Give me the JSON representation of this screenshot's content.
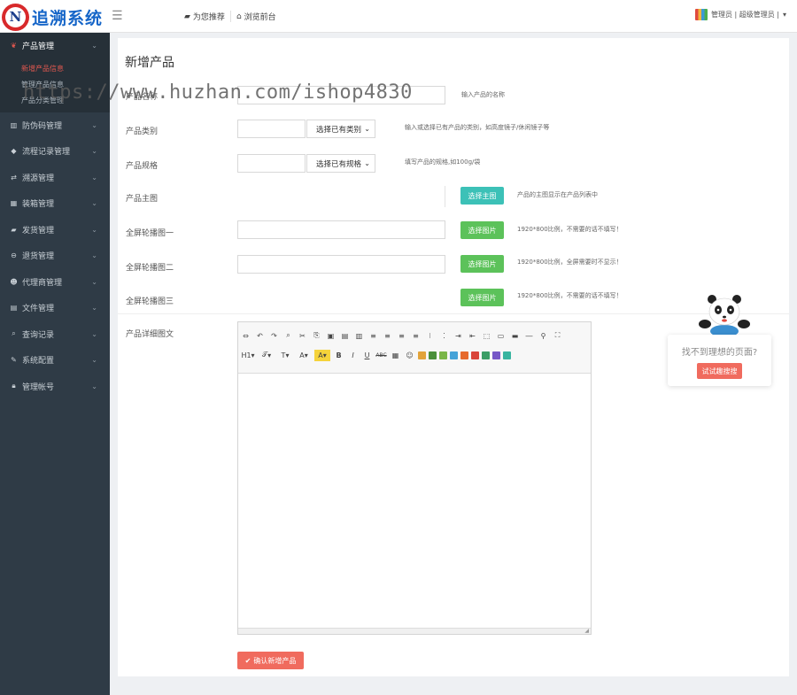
{
  "header": {
    "logo_text": "追溯系统",
    "nav": [
      {
        "icon": "briefcase-icon",
        "label": "为您推荐"
      },
      {
        "icon": "home-icon",
        "label": "浏览前台"
      }
    ],
    "user_label": "管理员 | 超级管理员 |"
  },
  "watermark": "https://www.huzhan.com/ishop4830",
  "sidebar": {
    "items": [
      {
        "label": "产品管理",
        "icon": "leaf-icon",
        "expanded": true
      },
      {
        "label": "防伪码管理",
        "icon": "barcode-icon"
      },
      {
        "label": "流程记录管理",
        "icon": "tag-icon"
      },
      {
        "label": "溯源管理",
        "icon": "retweet-icon"
      },
      {
        "label": "装箱管理",
        "icon": "grid-icon"
      },
      {
        "label": "发货管理",
        "icon": "truck-icon"
      },
      {
        "label": "退货管理",
        "icon": "minus-circle-icon"
      },
      {
        "label": "代理商管理",
        "icon": "users-icon"
      },
      {
        "label": "文件管理",
        "icon": "file-icon"
      },
      {
        "label": "查询记录",
        "icon": "search-icon"
      },
      {
        "label": "系统配置",
        "icon": "wrench-icon"
      },
      {
        "label": "管理帐号",
        "icon": "lock-icon"
      }
    ],
    "submenu": [
      {
        "label": "新增产品信息",
        "current": true
      },
      {
        "label": "管理产品信息",
        "current": false
      },
      {
        "label": "产品分类管理",
        "current": false
      }
    ]
  },
  "form": {
    "title": "新增产品",
    "rows": {
      "name": {
        "label": "产品名称",
        "hint": "输入产品的名称"
      },
      "category": {
        "label": "产品类别",
        "select": "选择已有类别",
        "hint": "输入或选择已有产品的类别，如高度镜子/休闲镜子等"
      },
      "spec": {
        "label": "产品规格",
        "select": "选择已有规格",
        "hint": "填写产品的规格,如100g/袋"
      },
      "main_image": {
        "label": "产品主图",
        "button": "选择主图",
        "hint": "产品的主图显示在产品列表中"
      },
      "carousel1": {
        "label": "全屏轮播图一",
        "button": "选择图片",
        "hint": "1920*800比例，不需要的话不填写！"
      },
      "carousel2": {
        "label": "全屏轮播图二",
        "button": "选择图片",
        "hint": "1920*800比例，全屏需要时不显示！"
      },
      "carousel3": {
        "label": "全屏轮播图三",
        "button": "选择图片",
        "hint": "1920*800比例，不需要的话不填写！"
      },
      "detail": {
        "label": "产品详细图文"
      }
    },
    "submit": "确认新增产品"
  },
  "editor_toolbar": {
    "heading": "H1",
    "font": "𝒯",
    "font_size": "T",
    "font_color": "A",
    "bold": "B",
    "italic": "I",
    "underline": "U",
    "strike": "ABC"
  },
  "widget": {
    "question": "找不到理想的页面?",
    "button": "试试趣搜搜"
  },
  "colors": {
    "accent_red": "#f06b5e",
    "teal": "#3cc1b7",
    "green": "#5cc25a",
    "sidebar_bg": "#2f3b46",
    "logo_blue": "#1565c8"
  }
}
